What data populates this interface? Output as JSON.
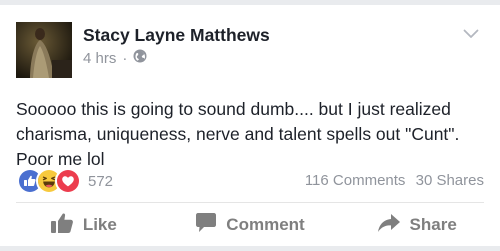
{
  "post": {
    "author": "Stacy Layne Matthews",
    "time": "4 hrs",
    "separator": "·",
    "privacy_icon": "globe-icon",
    "text": "Sooooo this is going to sound dumb.... but I just realized charisma, uniqueness, nerve and talent spells out \"Cunt\". Poor me lol"
  },
  "reactions": {
    "types": [
      "like",
      "haha",
      "love"
    ],
    "count": "572"
  },
  "stats": {
    "comments": "116 Comments",
    "shares": "30 Shares"
  },
  "actions": {
    "like": "Like",
    "comment": "Comment",
    "share": "Share"
  },
  "colors": {
    "like_blue": "#4a6fd0",
    "haha_yellow": "#f7c93d",
    "love_red": "#ec3d4e",
    "muted": "#90949c",
    "action_gray": "#7f7f7f"
  }
}
